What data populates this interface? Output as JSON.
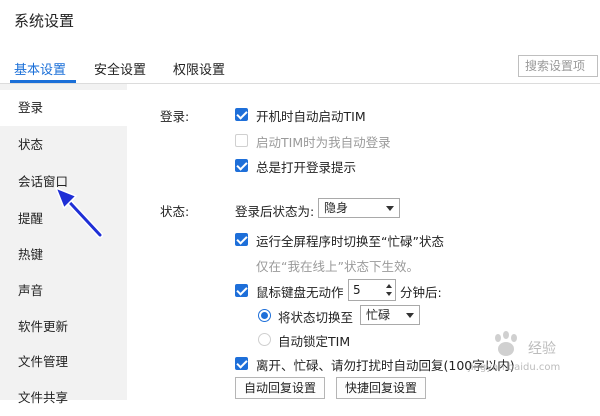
{
  "window": {
    "title": "系统设置"
  },
  "tabs": [
    {
      "label": "基本设置"
    },
    {
      "label": "安全设置"
    },
    {
      "label": "权限设置"
    }
  ],
  "search": {
    "placeholder": "搜索设置项"
  },
  "sidebar": {
    "items": [
      {
        "label": "登录"
      },
      {
        "label": "状态"
      },
      {
        "label": "会话窗口"
      },
      {
        "label": "提醒"
      },
      {
        "label": "热键"
      },
      {
        "label": "声音"
      },
      {
        "label": "软件更新"
      },
      {
        "label": "文件管理"
      },
      {
        "label": "文件共享"
      }
    ]
  },
  "login": {
    "section_label": "登录:",
    "auto_start": {
      "label": "开机时自动启动TIM",
      "checked": true
    },
    "auto_login": {
      "label": "启动TIM时为我自动登录",
      "checked": false,
      "disabled": true
    },
    "show_tips": {
      "label": "总是打开登录提示",
      "checked": true
    }
  },
  "status": {
    "section_label": "状态:",
    "after_login_label": "登录后状态为:",
    "after_login_value": "隐身",
    "fullscreen_busy": {
      "label": "运行全屏程序时切换至“忙碌”状态",
      "checked": true
    },
    "fullscreen_note": "仅在“我在线上”状态下生效。",
    "idle": {
      "label": "鼠标键盘无动作",
      "checked": true,
      "minutes": "5",
      "suffix": "分钟后:"
    },
    "switch_to": {
      "label": "将状态切换至",
      "value": "忙碌",
      "selected": true
    },
    "auto_lock": {
      "label": "自动锁定TIM",
      "selected": false
    },
    "auto_reply": {
      "label": "离开、忙碌、请勿打扰时自动回复(100字以内)",
      "checked": true
    },
    "buttons": {
      "auto_reply_settings": "自动回复设置",
      "quick_reply_settings": "快捷回复设置"
    }
  },
  "watermark": {
    "line1": "经验",
    "line2": "jingyan.baidu.com"
  },
  "colors": {
    "accent": "#1a6fd8",
    "sidebar_bg": "#f2f2f2",
    "pointer": "#1f2fd6"
  }
}
